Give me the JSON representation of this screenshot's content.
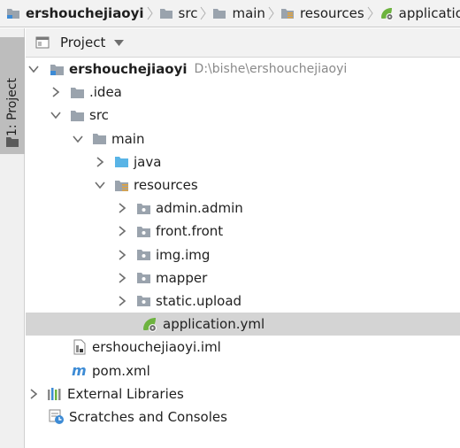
{
  "breadcrumb": [
    {
      "label": "ershouchejiaoyi",
      "icon": "module-folder-icon",
      "bold": true
    },
    {
      "label": "src",
      "icon": "folder-icon"
    },
    {
      "label": "main",
      "icon": "folder-icon"
    },
    {
      "label": "resources",
      "icon": "resources-folder-icon"
    },
    {
      "label": "application",
      "icon": "spring-config-icon"
    }
  ],
  "toolstrip": {
    "tab_label": "1: Project"
  },
  "panel": {
    "title": "Project"
  },
  "tree": {
    "root": {
      "label": "ershouchejiaoyi",
      "path": "D:\\bishe\\ershouchejiaoyi"
    },
    "idea": {
      "label": ".idea"
    },
    "src": {
      "label": "src"
    },
    "main": {
      "label": "main"
    },
    "java": {
      "label": "java"
    },
    "resources": {
      "label": "resources"
    },
    "admin": {
      "label": "admin.admin"
    },
    "front": {
      "label": "front.front"
    },
    "img": {
      "label": "img.img"
    },
    "mapper": {
      "label": "mapper"
    },
    "static": {
      "label": "static.upload"
    },
    "application": {
      "label": "application.yml"
    },
    "iml": {
      "label": "ershouchejiaoyi.iml"
    },
    "pom": {
      "label": "pom.xml"
    },
    "ext": {
      "label": "External Libraries"
    },
    "scratch": {
      "label": "Scratches and Consoles"
    }
  },
  "colors": {
    "folder": "#9aa3ad",
    "source_folder": "#59b4e6",
    "selection": "#d4d4d4",
    "spring": "#6db33f",
    "maven_m": "#3d8bd5"
  }
}
